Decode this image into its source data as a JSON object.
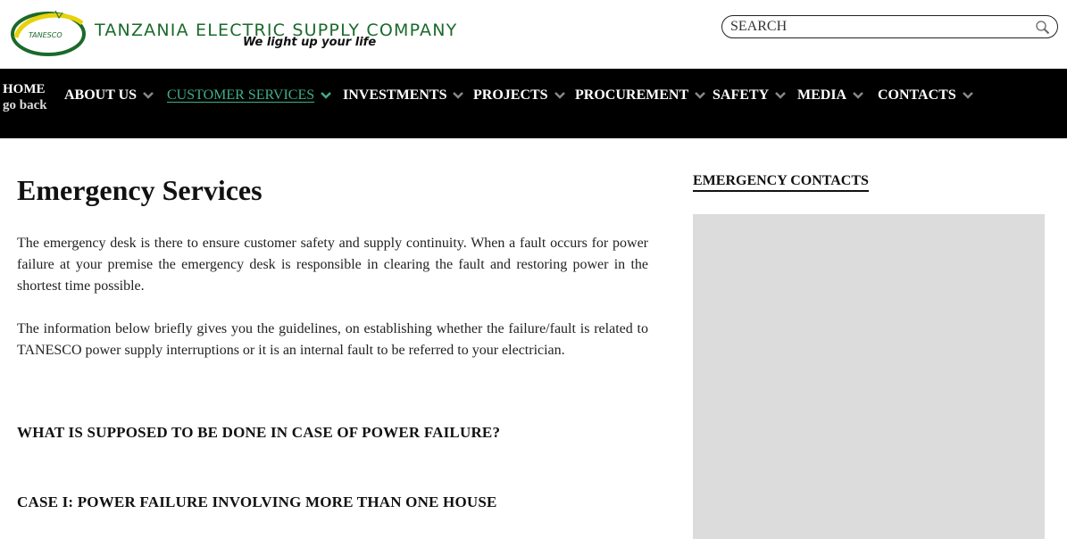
{
  "header": {
    "logo_text": "TANESCO",
    "company_name": "TANZANIA ELECTRIC SUPPLY COMPANY",
    "tagline": "We light up your life",
    "search_placeholder": "SEARCH",
    "brand_green": "#1a6a2a",
    "logo_yellow": "#e8d20a"
  },
  "nav": {
    "home_label": "HOME",
    "back_label": "go back",
    "items": [
      {
        "label": "ABOUT US",
        "active": false
      },
      {
        "label": "CUSTOMER SERVICES",
        "active": true
      },
      {
        "label": "INVESTMENTS",
        "active": false
      },
      {
        "label": "PROJECTS",
        "active": false
      },
      {
        "label": "PROCUREMENT",
        "active": false
      },
      {
        "label": "SAFETY",
        "active": false
      },
      {
        "label": "MEDIA",
        "active": false
      },
      {
        "label": "CONTACTS",
        "active": false
      }
    ],
    "active_color": "#3fae8c",
    "chevron_icon": "chevron-down-icon"
  },
  "main": {
    "title": "Emergency Services",
    "paragraphs": [
      "The emergency desk is there to ensure customer safety and supply continuity. When a fault occurs for power failure at your premise the emergency desk is responsible in clearing the fault and restoring power in the shortest time possible.",
      "The information below briefly gives you the guidelines, on establishing whether the failure/fault is related to TANESCO power supply interruptions or it is an internal fault to be referred to your electrician."
    ],
    "headings": [
      "WHAT IS SUPPOSED TO BE DONE IN CASE OF POWER FAILURE?",
      "CASE I: POWER FAILURE INVOLVING MORE THAN ONE HOUSE"
    ]
  },
  "sidebar": {
    "title": "EMERGENCY CONTACTS"
  }
}
